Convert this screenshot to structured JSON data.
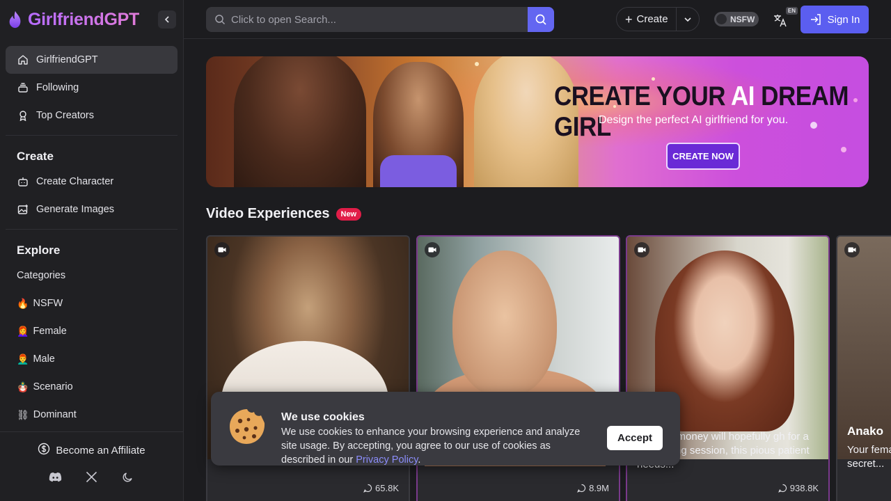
{
  "brand": {
    "name": "GirlfriendGPT"
  },
  "sidebar": {
    "primary": [
      {
        "label": "GirlfriendGPT",
        "icon": "home-icon",
        "active": true
      },
      {
        "label": "Following",
        "icon": "layers-icon"
      },
      {
        "label": "Top Creators",
        "icon": "award-icon"
      }
    ],
    "create": {
      "title": "Create",
      "items": [
        {
          "label": "Create Character",
          "icon": "bot-icon"
        },
        {
          "label": "Generate Images",
          "icon": "image-plus-icon"
        }
      ]
    },
    "explore": {
      "title": "Explore",
      "items": [
        {
          "label": "Categories",
          "emoji": ""
        },
        {
          "label": "NSFW",
          "emoji": "🔥"
        },
        {
          "label": "Female",
          "emoji": "👩‍🦰"
        },
        {
          "label": "Male",
          "emoji": "👨‍🦰"
        },
        {
          "label": "Scenario",
          "emoji": "🪆"
        },
        {
          "label": "Dominant",
          "emoji": "⛓"
        }
      ]
    },
    "affiliate": {
      "label": "Become an Affiliate"
    },
    "social": [
      "discord-icon",
      "x-icon",
      "moon-icon"
    ]
  },
  "header": {
    "search_placeholder": "Click to open Search...",
    "create_label": "Create",
    "nsfw_label": "NSFW",
    "lang_badge": "EN",
    "signin_label": "Sign In",
    "accent": "#5b5ef0"
  },
  "banner": {
    "title_pre": "CREATE YOUR ",
    "title_ai": "AI",
    "title_post": " DREAM GIRL",
    "subtitle": "Design the perfect AI girlfriend for you.",
    "cta": "CREATE NOW"
  },
  "videos": {
    "title": "Video Experiences",
    "badge": "New",
    "cards": [
      {
        "name": "",
        "desc": "",
        "count": "65.8K"
      },
      {
        "name": "",
        "desc": "",
        "count": "8.9M"
      },
      {
        "name": "",
        "desc": "birthday money will hopefully gh for a counseling session, this pious patient needs...",
        "count": "938.8K"
      },
      {
        "name": "Anako",
        "desc": "Your fema secret...",
        "count": ""
      }
    ]
  },
  "cookie": {
    "title": "We use cookies",
    "body": "We use cookies to enhance your browsing experience and analyze site usage. By accepting, you agree to our use of cookies as described in our ",
    "link": "Privacy Policy",
    "suffix": ".",
    "accept": "Accept"
  }
}
